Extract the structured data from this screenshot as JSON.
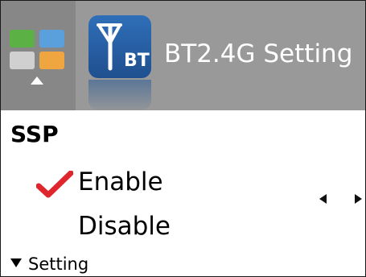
{
  "header": {
    "title": "BT2.4G Setting",
    "app_icon_label": "BT"
  },
  "ssp": {
    "title": "SSP",
    "options": [
      {
        "label": "Enable",
        "selected": true
      },
      {
        "label": "Disable",
        "selected": false
      }
    ]
  },
  "footer": {
    "setting_label": "Setting"
  },
  "icons": {
    "home": "apps-grid-icon",
    "up": "up-arrow-icon",
    "bt": "bluetooth-antenna-icon",
    "check": "check-icon",
    "prev": "left-arrow-icon",
    "next": "right-arrow-icon",
    "expand": "caret-down-icon"
  },
  "colors": {
    "header_bg": "#999999",
    "home_bg": "#878787",
    "check": "#e0262d",
    "bt_blue": "#2f6fb8"
  }
}
